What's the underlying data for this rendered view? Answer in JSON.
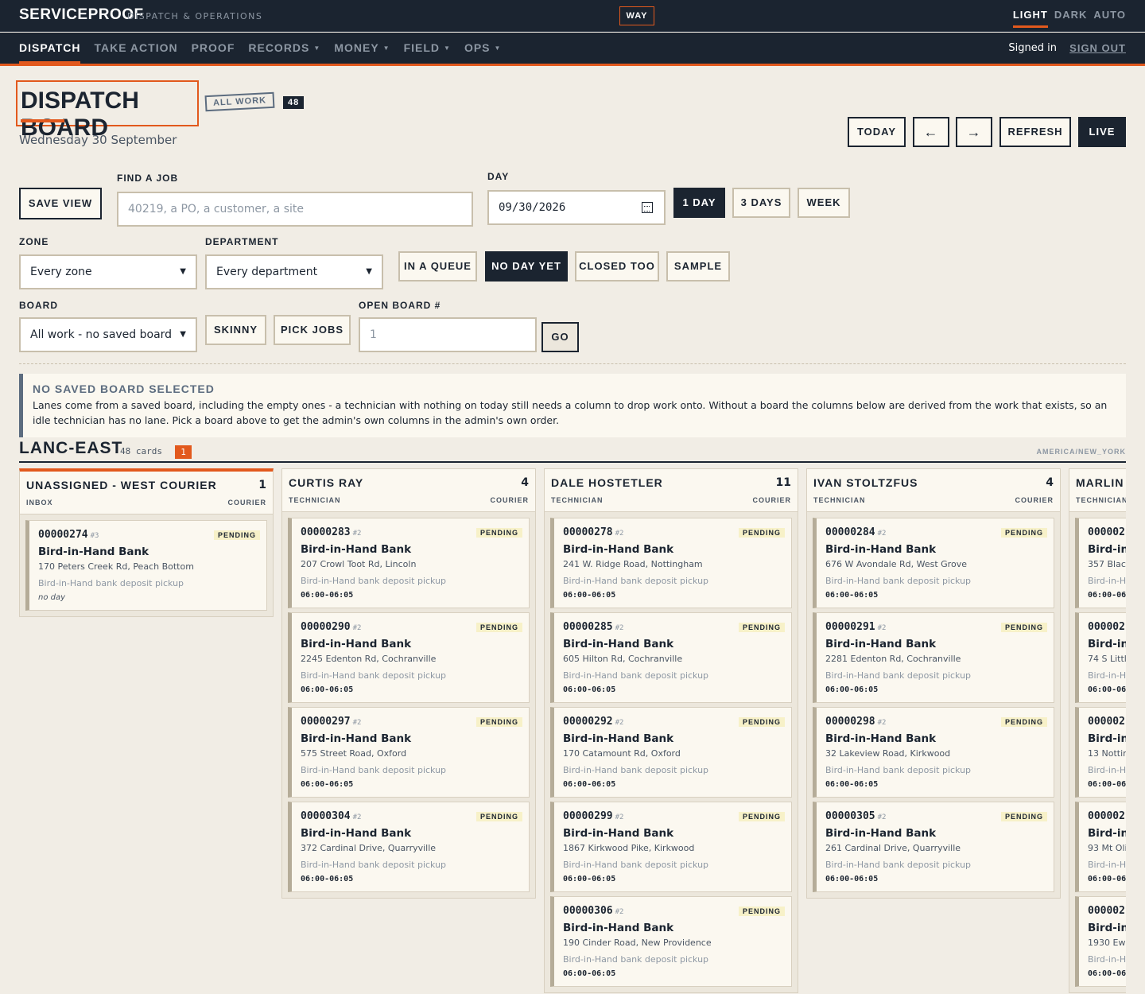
{
  "header": {
    "brand": "SERVICEPROOF",
    "brand_sub": "DISPATCH & OPERATIONS",
    "way": "WAY",
    "themes": [
      "LIGHT",
      "DARK",
      "AUTO"
    ]
  },
  "nav": {
    "items": [
      "DISPATCH",
      "TAKE ACTION",
      "PROOF",
      "RECORDS",
      "MONEY",
      "FIELD",
      "OPS"
    ],
    "signed_in": "Signed in",
    "sign_out": "SIGN OUT"
  },
  "page": {
    "title": "DISPATCH BOARD",
    "tag": "ALL WORK",
    "count": "48",
    "date": "Wednesday 30 September"
  },
  "toolbar": {
    "today": "TODAY",
    "prev": "←",
    "next": "→",
    "refresh": "REFRESH",
    "live": "LIVE"
  },
  "filters": {
    "save_view": "SAVE VIEW",
    "find_label": "FIND A JOB",
    "find_placeholder": "40219, a PO, a customer, a site",
    "day_label": "DAY",
    "day_value": "09/30/2026",
    "range": [
      "1 DAY",
      "3 DAYS",
      "WEEK"
    ],
    "zone_label": "ZONE",
    "zone_value": "Every zone",
    "dept_label": "DEPARTMENT",
    "dept_value": "Every department",
    "toggles": [
      "IN A QUEUE",
      "NO DAY YET",
      "CLOSED TOO",
      "SAMPLE"
    ],
    "board_label": "BOARD",
    "board_value": "All work - no saved board",
    "skinny": "SKINNY",
    "pick_jobs": "PICK JOBS",
    "open_board_label": "OPEN BOARD #",
    "open_board_placeholder": "1",
    "go": "GO"
  },
  "notice": {
    "title": "NO SAVED BOARD SELECTED",
    "body": "Lanes come from a saved board, including the empty ones - a technician with nothing on today still needs a column to drop work onto. Without a board the columns below are derived from the work that exists, so an idle technician has no lane. Pick a board above to get the admin's own columns in the admin's own order."
  },
  "zone": {
    "name": "LANC-EAST",
    "cards": "48 cards",
    "badge": "1",
    "tz": "AMERICA/NEW_YORK"
  },
  "lanes": [
    {
      "name": "UNASSIGNED - WEST COURIER",
      "count": "1",
      "role": "INBOX",
      "type": "COURIER",
      "cards": [
        {
          "id": "00000274",
          "seq": "#3",
          "status": "PENDING",
          "customer": "Bird-in-Hand Bank",
          "address": "170 Peters Creek Rd, Peach Bottom",
          "desc": "Bird-in-Hand bank deposit pickup",
          "time": "",
          "note": "no day"
        }
      ]
    },
    {
      "name": "CURTIS RAY",
      "count": "4",
      "role": "TECHNICIAN",
      "type": "COURIER",
      "cards": [
        {
          "id": "00000283",
          "seq": "#2",
          "status": "PENDING",
          "customer": "Bird-in-Hand Bank",
          "address": "207 Crowl Toot Rd, Lincoln",
          "desc": "Bird-in-Hand bank deposit pickup",
          "time": "06:00-06:05",
          "note": ""
        },
        {
          "id": "00000290",
          "seq": "#2",
          "status": "PENDING",
          "customer": "Bird-in-Hand Bank",
          "address": "2245 Edenton Rd, Cochranville",
          "desc": "Bird-in-Hand bank deposit pickup",
          "time": "06:00-06:05",
          "note": ""
        },
        {
          "id": "00000297",
          "seq": "#2",
          "status": "PENDING",
          "customer": "Bird-in-Hand Bank",
          "address": "575 Street Road, Oxford",
          "desc": "Bird-in-Hand bank deposit pickup",
          "time": "06:00-06:05",
          "note": ""
        },
        {
          "id": "00000304",
          "seq": "#2",
          "status": "PENDING",
          "customer": "Bird-in-Hand Bank",
          "address": "372 Cardinal Drive, Quarryville",
          "desc": "Bird-in-Hand bank deposit pickup",
          "time": "06:00-06:05",
          "note": ""
        }
      ]
    },
    {
      "name": "DALE HOSTETLER",
      "count": "11",
      "role": "TECHNICIAN",
      "type": "COURIER",
      "cards": [
        {
          "id": "00000278",
          "seq": "#2",
          "status": "PENDING",
          "customer": "Bird-in-Hand Bank",
          "address": "241 W. Ridge Road, Nottingham",
          "desc": "Bird-in-Hand bank deposit pickup",
          "time": "06:00-06:05",
          "note": ""
        },
        {
          "id": "00000285",
          "seq": "#2",
          "status": "PENDING",
          "customer": "Bird-in-Hand Bank",
          "address": "605 Hilton Rd, Cochranville",
          "desc": "Bird-in-Hand bank deposit pickup",
          "time": "06:00-06:05",
          "note": ""
        },
        {
          "id": "00000292",
          "seq": "#2",
          "status": "PENDING",
          "customer": "Bird-in-Hand Bank",
          "address": "170 Catamount Rd, Oxford",
          "desc": "Bird-in-Hand bank deposit pickup",
          "time": "06:00-06:05",
          "note": ""
        },
        {
          "id": "00000299",
          "seq": "#2",
          "status": "PENDING",
          "customer": "Bird-in-Hand Bank",
          "address": "1867 Kirkwood Pike, Kirkwood",
          "desc": "Bird-in-Hand bank deposit pickup",
          "time": "06:00-06:05",
          "note": ""
        },
        {
          "id": "00000306",
          "seq": "#2",
          "status": "PENDING",
          "customer": "Bird-in-Hand Bank",
          "address": "190 Cinder Road, New Providence",
          "desc": "Bird-in-Hand bank deposit pickup",
          "time": "06:00-06:05",
          "note": ""
        }
      ]
    },
    {
      "name": "IVAN STOLTZFUS",
      "count": "4",
      "role": "TECHNICIAN",
      "type": "COURIER",
      "cards": [
        {
          "id": "00000284",
          "seq": "#2",
          "status": "PENDING",
          "customer": "Bird-in-Hand Bank",
          "address": "676 W Avondale Rd, West Grove",
          "desc": "Bird-in-Hand bank deposit pickup",
          "time": "06:00-06:05",
          "note": ""
        },
        {
          "id": "00000291",
          "seq": "#2",
          "status": "PENDING",
          "customer": "Bird-in-Hand Bank",
          "address": "2281 Edenton Rd, Cochranville",
          "desc": "Bird-in-Hand bank deposit pickup",
          "time": "06:00-06:05",
          "note": ""
        },
        {
          "id": "00000298",
          "seq": "#2",
          "status": "PENDING",
          "customer": "Bird-in-Hand Bank",
          "address": "32 Lakeview Road, Kirkwood",
          "desc": "Bird-in-Hand bank deposit pickup",
          "time": "06:00-06:05",
          "note": ""
        },
        {
          "id": "00000305",
          "seq": "#2",
          "status": "PENDING",
          "customer": "Bird-in-Hand Bank",
          "address": "261 Cardinal Drive, Quarryville",
          "desc": "Bird-in-Hand bank deposit pickup",
          "time": "06:00-06:05",
          "note": ""
        }
      ]
    },
    {
      "name": "MARLIN",
      "count": "",
      "role": "TECHNICIAN",
      "type": "",
      "cards": [
        {
          "id": "000002",
          "seq": "",
          "status": "",
          "customer": "Bird-in-",
          "address": "357 Black",
          "desc": "Bird-in-H",
          "time": "06:00-06",
          "note": ""
        },
        {
          "id": "000002",
          "seq": "",
          "status": "",
          "customer": "Bird-in-",
          "address": "74 S Little",
          "desc": "Bird-in-H",
          "time": "06:00-06",
          "note": ""
        },
        {
          "id": "000002",
          "seq": "",
          "status": "",
          "customer": "Bird-in-",
          "address": "13 Nottin",
          "desc": "Bird-in-H",
          "time": "06:00-06",
          "note": ""
        },
        {
          "id": "000002",
          "seq": "",
          "status": "",
          "customer": "Bird-in-",
          "address": "93 Mt Oliv",
          "desc": "Bird-in-H",
          "time": "06:00-06",
          "note": ""
        },
        {
          "id": "000002",
          "seq": "",
          "status": "",
          "customer": "Bird-in-",
          "address": "1930 Ewir",
          "desc": "Bird-in-H",
          "time": "06:00-06",
          "note": ""
        }
      ]
    }
  ]
}
